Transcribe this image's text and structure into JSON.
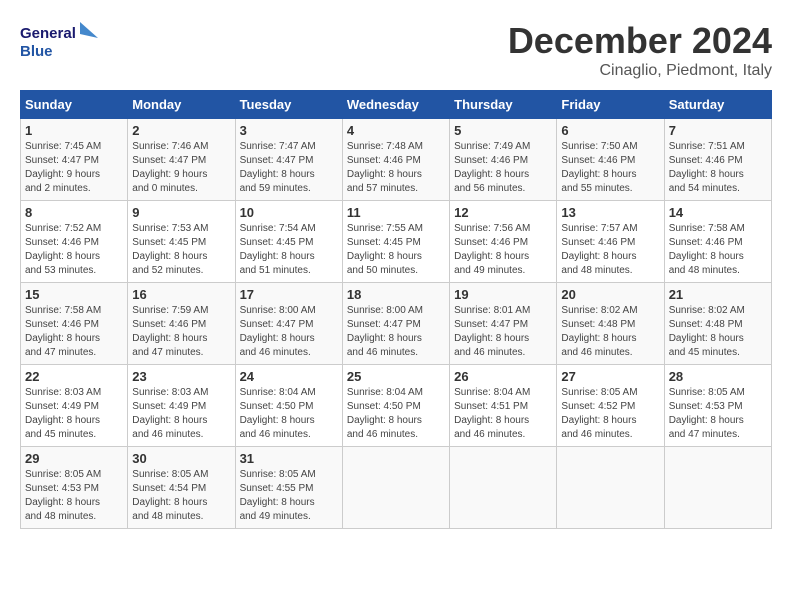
{
  "header": {
    "logo_text_general": "General",
    "logo_text_blue": "Blue",
    "month_title": "December 2024",
    "location": "Cinaglio, Piedmont, Italy"
  },
  "columns": [
    "Sunday",
    "Monday",
    "Tuesday",
    "Wednesday",
    "Thursday",
    "Friday",
    "Saturday"
  ],
  "weeks": [
    [
      {
        "day": "1",
        "info": "Sunrise: 7:45 AM\nSunset: 4:47 PM\nDaylight: 9 hours\nand 2 minutes."
      },
      {
        "day": "2",
        "info": "Sunrise: 7:46 AM\nSunset: 4:47 PM\nDaylight: 9 hours\nand 0 minutes."
      },
      {
        "day": "3",
        "info": "Sunrise: 7:47 AM\nSunset: 4:47 PM\nDaylight: 8 hours\nand 59 minutes."
      },
      {
        "day": "4",
        "info": "Sunrise: 7:48 AM\nSunset: 4:46 PM\nDaylight: 8 hours\nand 57 minutes."
      },
      {
        "day": "5",
        "info": "Sunrise: 7:49 AM\nSunset: 4:46 PM\nDaylight: 8 hours\nand 56 minutes."
      },
      {
        "day": "6",
        "info": "Sunrise: 7:50 AM\nSunset: 4:46 PM\nDaylight: 8 hours\nand 55 minutes."
      },
      {
        "day": "7",
        "info": "Sunrise: 7:51 AM\nSunset: 4:46 PM\nDaylight: 8 hours\nand 54 minutes."
      }
    ],
    [
      {
        "day": "8",
        "info": "Sunrise: 7:52 AM\nSunset: 4:46 PM\nDaylight: 8 hours\nand 53 minutes."
      },
      {
        "day": "9",
        "info": "Sunrise: 7:53 AM\nSunset: 4:45 PM\nDaylight: 8 hours\nand 52 minutes."
      },
      {
        "day": "10",
        "info": "Sunrise: 7:54 AM\nSunset: 4:45 PM\nDaylight: 8 hours\nand 51 minutes."
      },
      {
        "day": "11",
        "info": "Sunrise: 7:55 AM\nSunset: 4:45 PM\nDaylight: 8 hours\nand 50 minutes."
      },
      {
        "day": "12",
        "info": "Sunrise: 7:56 AM\nSunset: 4:46 PM\nDaylight: 8 hours\nand 49 minutes."
      },
      {
        "day": "13",
        "info": "Sunrise: 7:57 AM\nSunset: 4:46 PM\nDaylight: 8 hours\nand 48 minutes."
      },
      {
        "day": "14",
        "info": "Sunrise: 7:58 AM\nSunset: 4:46 PM\nDaylight: 8 hours\nand 48 minutes."
      }
    ],
    [
      {
        "day": "15",
        "info": "Sunrise: 7:58 AM\nSunset: 4:46 PM\nDaylight: 8 hours\nand 47 minutes."
      },
      {
        "day": "16",
        "info": "Sunrise: 7:59 AM\nSunset: 4:46 PM\nDaylight: 8 hours\nand 47 minutes."
      },
      {
        "day": "17",
        "info": "Sunrise: 8:00 AM\nSunset: 4:47 PM\nDaylight: 8 hours\nand 46 minutes."
      },
      {
        "day": "18",
        "info": "Sunrise: 8:00 AM\nSunset: 4:47 PM\nDaylight: 8 hours\nand 46 minutes."
      },
      {
        "day": "19",
        "info": "Sunrise: 8:01 AM\nSunset: 4:47 PM\nDaylight: 8 hours\nand 46 minutes."
      },
      {
        "day": "20",
        "info": "Sunrise: 8:02 AM\nSunset: 4:48 PM\nDaylight: 8 hours\nand 46 minutes."
      },
      {
        "day": "21",
        "info": "Sunrise: 8:02 AM\nSunset: 4:48 PM\nDaylight: 8 hours\nand 45 minutes."
      }
    ],
    [
      {
        "day": "22",
        "info": "Sunrise: 8:03 AM\nSunset: 4:49 PM\nDaylight: 8 hours\nand 45 minutes."
      },
      {
        "day": "23",
        "info": "Sunrise: 8:03 AM\nSunset: 4:49 PM\nDaylight: 8 hours\nand 46 minutes."
      },
      {
        "day": "24",
        "info": "Sunrise: 8:04 AM\nSunset: 4:50 PM\nDaylight: 8 hours\nand 46 minutes."
      },
      {
        "day": "25",
        "info": "Sunrise: 8:04 AM\nSunset: 4:50 PM\nDaylight: 8 hours\nand 46 minutes."
      },
      {
        "day": "26",
        "info": "Sunrise: 8:04 AM\nSunset: 4:51 PM\nDaylight: 8 hours\nand 46 minutes."
      },
      {
        "day": "27",
        "info": "Sunrise: 8:05 AM\nSunset: 4:52 PM\nDaylight: 8 hours\nand 46 minutes."
      },
      {
        "day": "28",
        "info": "Sunrise: 8:05 AM\nSunset: 4:53 PM\nDaylight: 8 hours\nand 47 minutes."
      }
    ],
    [
      {
        "day": "29",
        "info": "Sunrise: 8:05 AM\nSunset: 4:53 PM\nDaylight: 8 hours\nand 48 minutes."
      },
      {
        "day": "30",
        "info": "Sunrise: 8:05 AM\nSunset: 4:54 PM\nDaylight: 8 hours\nand 48 minutes."
      },
      {
        "day": "31",
        "info": "Sunrise: 8:05 AM\nSunset: 4:55 PM\nDaylight: 8 hours\nand 49 minutes."
      },
      null,
      null,
      null,
      null
    ]
  ]
}
